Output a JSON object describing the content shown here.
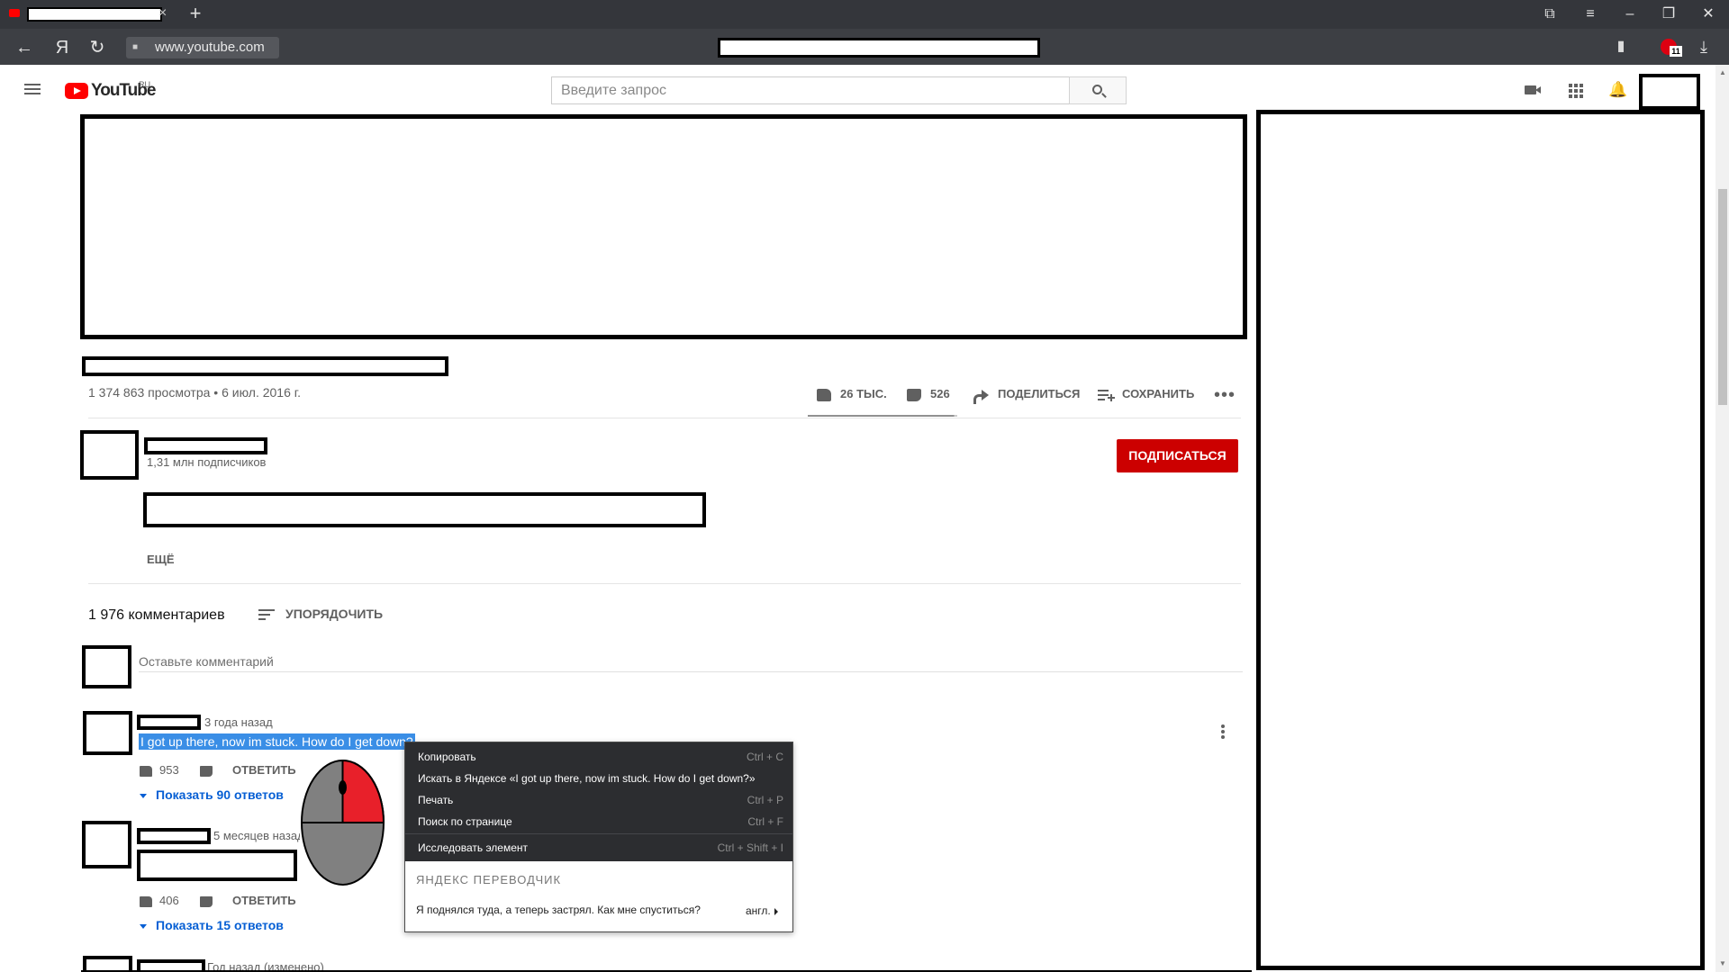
{
  "browser": {
    "address": "www.youtube.com",
    "new_tab": "+",
    "tab_close": "×"
  },
  "masthead": {
    "logo_text": "YouTube",
    "logo_region": "RU",
    "search_placeholder": "Введите запрос"
  },
  "video": {
    "views_date": "1 374 863 просмотра • 6 июл. 2016 г.",
    "likes": "26 ТЫС.",
    "dislikes": "526",
    "share_label": "ПОДЕЛИТЬСЯ",
    "save_label": "СОХРАНИТЬ",
    "like_ratio": 0.98
  },
  "channel": {
    "subscribers": "1,31 млн подписчиков",
    "subscribe_label": "ПОДПИСАТЬСЯ",
    "more_label": "ЕЩЁ"
  },
  "comments": {
    "count_label": "1 976 комментариев",
    "sort_label": "УПОРЯДОЧИТЬ",
    "input_placeholder": "Оставьте комментарий",
    "items": [
      {
        "time": "3 года назад",
        "text": "I got up there, now im stuck. How do I get down?",
        "likes": "953",
        "reply_label": "ОТВЕТИТЬ",
        "show_replies": "Показать 90 ответов"
      },
      {
        "time": "5 месяцев назад",
        "likes": "406",
        "reply_label": "ОТВЕТИТЬ",
        "show_replies": "Показать 15 ответов"
      },
      {
        "time": "Год назад (изменено)"
      }
    ]
  },
  "context_menu": {
    "items": [
      {
        "label": "Копировать",
        "shortcut": "Ctrl + C"
      },
      {
        "label": "Искать в Яндексе «I got up there, now im stuck. How do I get down?»",
        "shortcut": ""
      },
      {
        "label": "Печать",
        "shortcut": "Ctrl + P"
      },
      {
        "label": "Поиск по странице",
        "shortcut": "Ctrl + F"
      },
      {
        "label": "Исследовать элемент",
        "shortcut": "Ctrl + Shift + I"
      }
    ],
    "translator_header": "ЯНДЕКС ПЕРЕВОДЧИК",
    "translation": "Я поднялся туда, а теперь застрял. Как мне спуститься?",
    "translation_lang": "англ."
  },
  "colors": {
    "browser_dark": "#34363b",
    "subscribe_red": "#cc0000",
    "link_blue": "#065fd4",
    "selection_blue": "#3a8ee6",
    "mouse_button_highlight": "#e8202a"
  }
}
